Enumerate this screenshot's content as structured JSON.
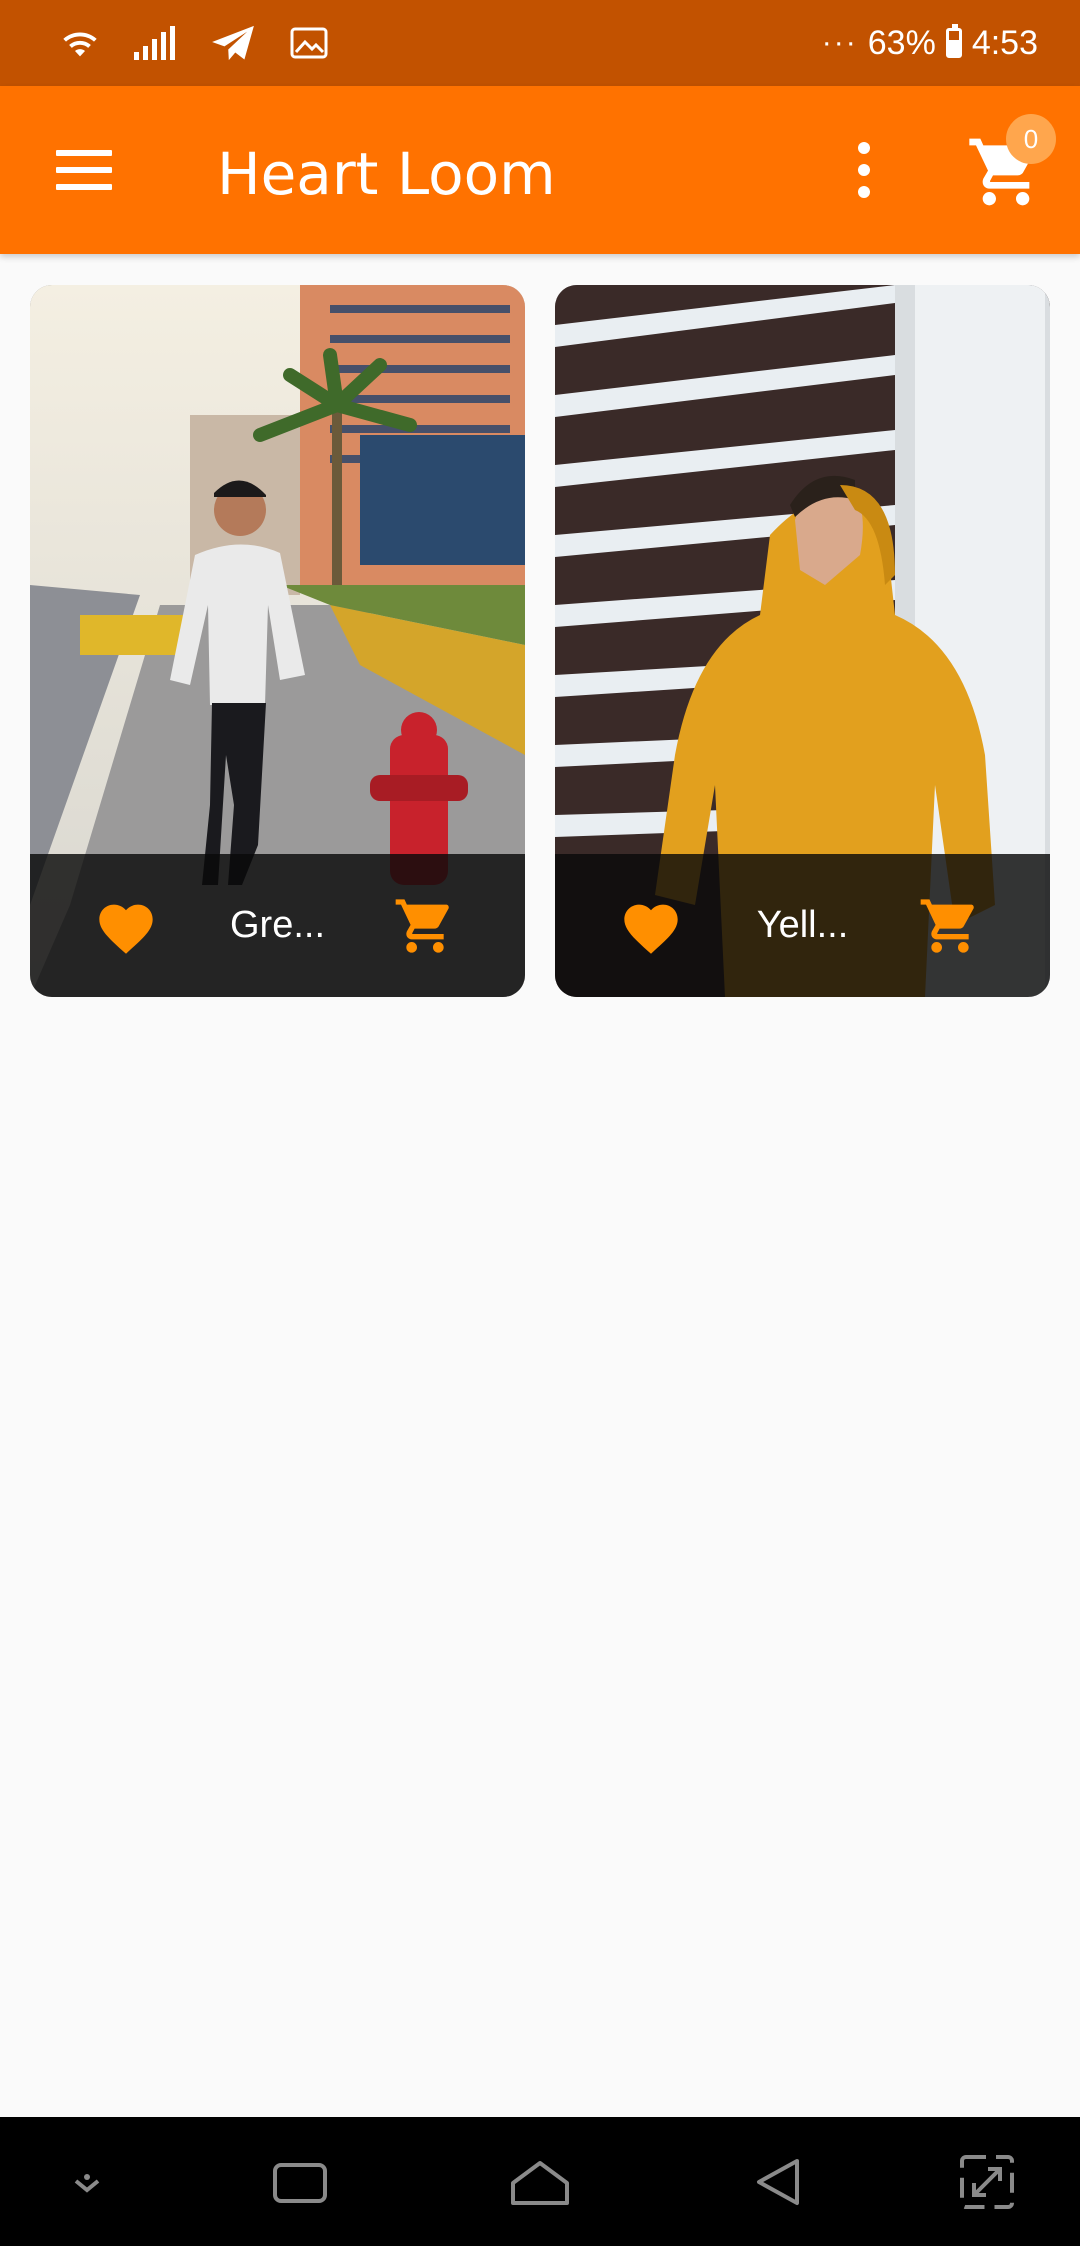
{
  "status_bar": {
    "battery": "63%",
    "time": "4:53",
    "icons": [
      "wifi-icon",
      "signal-icon",
      "telegram-icon",
      "image-icon",
      "battery-icon"
    ]
  },
  "app_bar": {
    "title": "Heart Loom",
    "cart_count": "0",
    "icons": [
      "hamburger-menu-icon",
      "more-vert-icon",
      "shopping-cart-icon"
    ]
  },
  "products": [
    {
      "name": "Gre...",
      "image": "man in grey sweatshirt by hydrant",
      "icons": [
        "heart-icon",
        "add-to-cart-icon"
      ]
    },
    {
      "name": "Yell...",
      "image": "man in yellow hoodie by building",
      "icons": [
        "heart-icon",
        "add-to-cart-icon"
      ]
    }
  ],
  "nav_bar": {
    "icons": [
      "hide-keyboard-icon",
      "recent-apps-icon",
      "home-icon",
      "back-icon",
      "screen-rotate-icon"
    ]
  },
  "colors": {
    "status_bar": "#c25200",
    "app_bar": "#ff7200",
    "accent": "#ff8f00",
    "badge": "#ffa64d",
    "background": "#fafafa"
  }
}
